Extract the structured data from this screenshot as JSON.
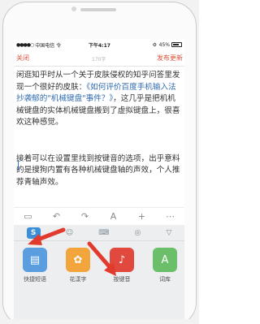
{
  "status_bar": {
    "signal": "●●●●○",
    "carrier": "中国电信",
    "wifi": "令",
    "time": "下午4:17",
    "gear": "⚙",
    "battery_pct": "45%",
    "battery_level": 0.45
  },
  "nav": {
    "close_label": "关闭",
    "char_count": "170字",
    "publish_label": "发布更新"
  },
  "content": {
    "p1_before": "闲逛知乎时从一个关于皮肤侵权的知乎问答里发现一个很好的皮肤：",
    "p1_link": "《如何评价百度手机输入法抄袭郁的\"机械键盘\"事件？》",
    "p1_after": "，这几乎是把机机械键盘的实体机械键盘搬到了虚拟键盘上，很喜欢这种感觉。",
    "p2": "接着可以在设置里找到按键音的选项，出乎意料的是搜狗内置有各种机械键盘轴的声效，个人推荐青轴声效。"
  },
  "edit_toolbar": {
    "icons": [
      "comment-icon",
      "undo-icon",
      "redo-icon",
      "font-icon",
      "add-icon",
      "more-icon"
    ],
    "glyphs": [
      "▭",
      "↶",
      "↷",
      "A",
      "+",
      "⋯"
    ]
  },
  "keyboard": {
    "top_bar": {
      "logo_glyph": "S",
      "emoji_glyph": "☺",
      "keyboard_glyph": "⌨",
      "mic_glyph": "◎",
      "collapse_glyph": "▽"
    },
    "apps": [
      {
        "label": "快捷短语",
        "glyph": "▤",
        "color": "#5b9ee0"
      },
      {
        "label": "花漾字",
        "glyph": "✿",
        "color": "#f2a53b"
      },
      {
        "label": "按键音",
        "glyph": "♪",
        "color": "#e2493e"
      },
      {
        "label": "词库",
        "glyph": "A",
        "color": "#6cbf6a"
      }
    ],
    "accent_color": "#e23b2e"
  }
}
